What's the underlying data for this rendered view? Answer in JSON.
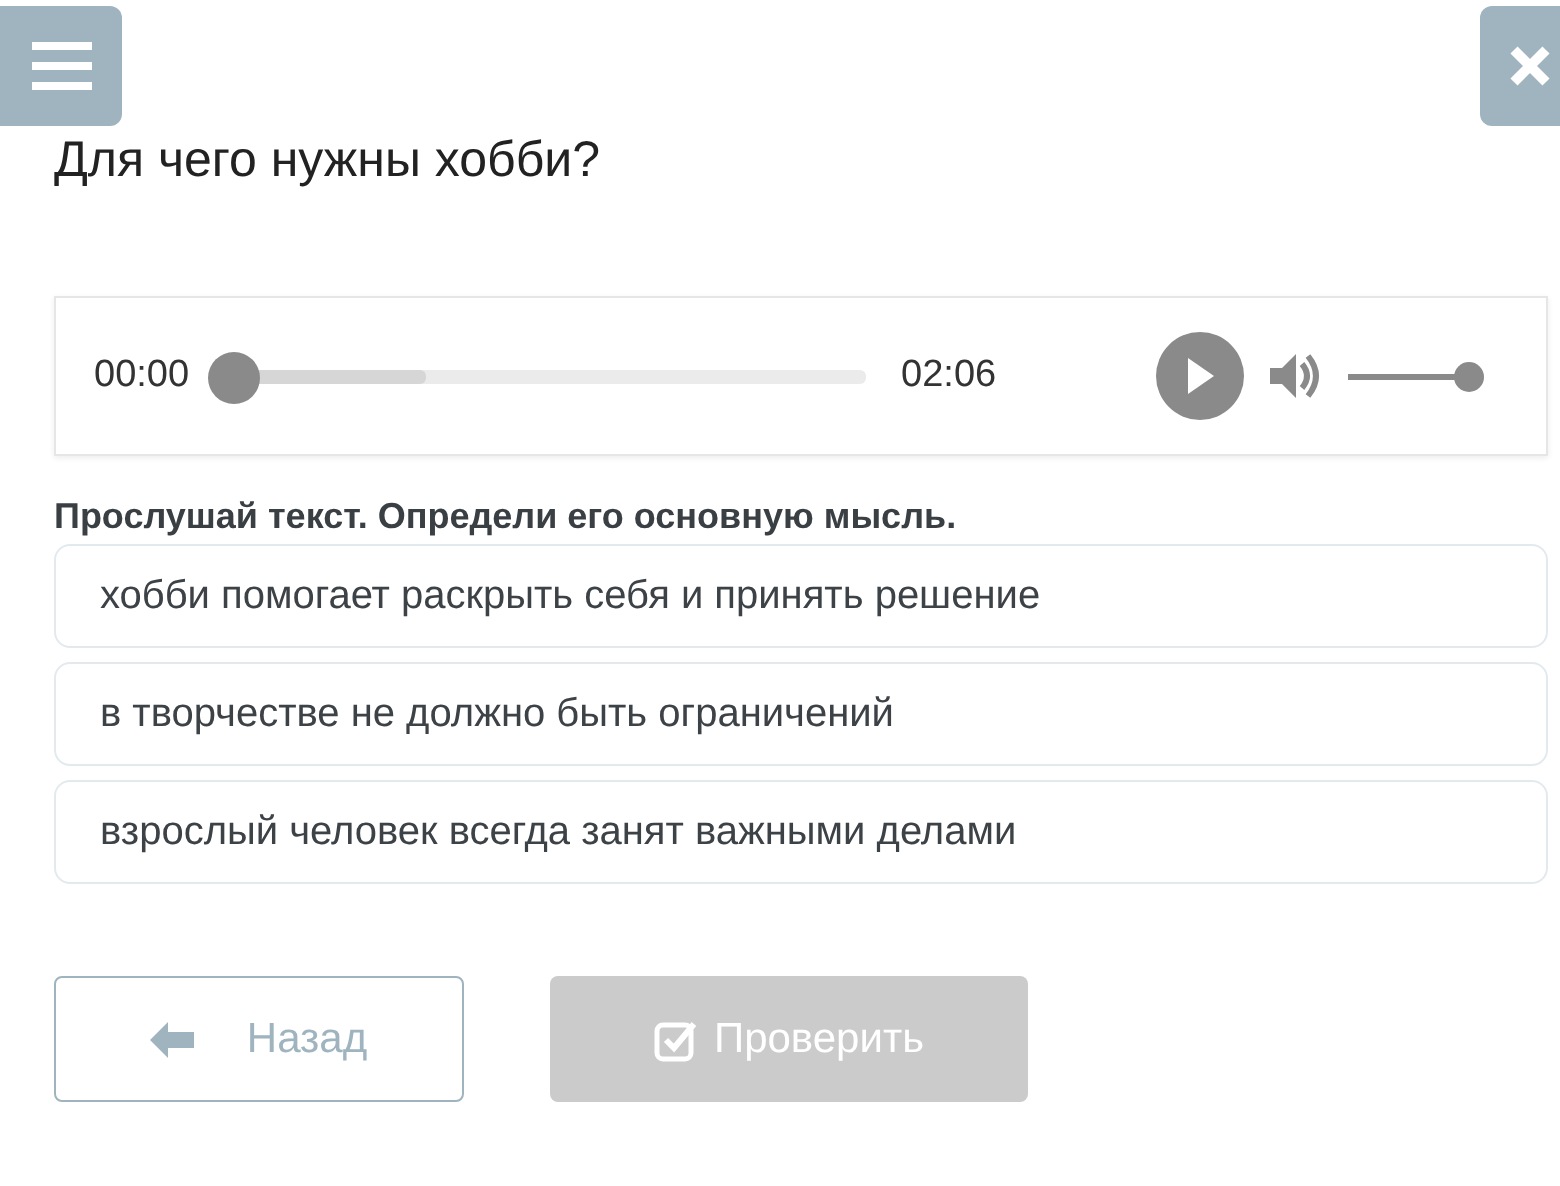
{
  "title": "Для чего нужны хобби?",
  "player": {
    "current": "00:00",
    "duration": "02:06",
    "progress": {
      "level": 0
    },
    "buffered": {
      "level": 0.33
    },
    "volume": {
      "level": 1
    }
  },
  "instruction": "Прослушай текст. Определи его основную мысль.",
  "options": [
    {
      "text": "хобби помогает раскрыть себя и принять решение",
      "selected": false
    },
    {
      "text": "в творчестве не должно быть ограничений",
      "selected": false
    },
    {
      "text": "взрослый человек всегда занят важными делами",
      "selected": false
    }
  ],
  "back_button": {
    "label": "Назад"
  },
  "check_button": {
    "label": "Проверить",
    "disabled": true
  }
}
